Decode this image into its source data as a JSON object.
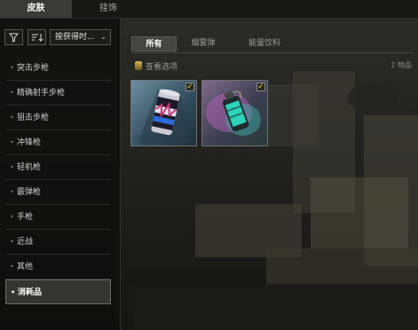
{
  "tabs": [
    {
      "label": "皮肤",
      "active": true
    },
    {
      "label": "挂饰",
      "active": false
    }
  ],
  "filter": {
    "filter_icon": "funnel-icon",
    "sort_icon": "sort-order-icon",
    "sort_label": "按获得时..."
  },
  "categories": [
    {
      "label": "突击步枪"
    },
    {
      "label": "精确射手步枪"
    },
    {
      "label": "狙击步枪"
    },
    {
      "label": "冲锋枪"
    },
    {
      "label": "轻机枪"
    },
    {
      "label": "霰弹枪"
    },
    {
      "label": "手枪"
    },
    {
      "label": "近战"
    },
    {
      "label": "其他"
    },
    {
      "label": "消耗品",
      "selected": true
    }
  ],
  "subtabs": [
    {
      "label": "所有",
      "active": true
    },
    {
      "label": "烟雾弹",
      "active": false
    },
    {
      "label": "能量饮料",
      "active": false
    }
  ],
  "view_options": {
    "label": "查看选项",
    "icon": "options-icon"
  },
  "item_count": "2 物品",
  "items": [
    {
      "name": "energy-drink-can",
      "equipped": true
    },
    {
      "name": "smoke-grenade",
      "equipped": true
    }
  ],
  "colors": {
    "accent_check": "#f0d23a",
    "tab_active": "#3a3a38"
  }
}
